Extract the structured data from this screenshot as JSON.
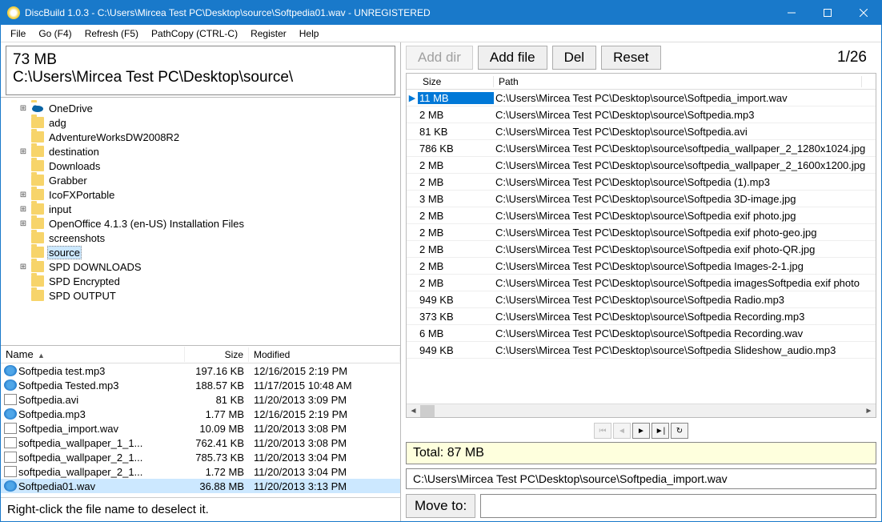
{
  "titlebar": {
    "title": "DiscBuild 1.0.3 - C:\\Users\\Mircea Test PC\\Desktop\\source\\Softpedia01.wav - UNREGISTERED"
  },
  "menu": {
    "file": "File",
    "go": "Go (F4)",
    "refresh": "Refresh (F5)",
    "pathcopy": "PathCopy (CTRL-C)",
    "register": "Register",
    "help": "Help"
  },
  "info": {
    "size": "73 MB",
    "path": "C:\\Users\\Mircea Test PC\\Desktop\\source\\"
  },
  "tree": [
    {
      "exp": "⊞",
      "icon": "onedrive",
      "label": "OneDrive",
      "indent": 1
    },
    {
      "exp": "",
      "icon": "folder",
      "label": "adg",
      "indent": 1
    },
    {
      "exp": "",
      "icon": "folder",
      "label": "AdventureWorksDW2008R2",
      "indent": 1
    },
    {
      "exp": "⊞",
      "icon": "folder",
      "label": "destination",
      "indent": 1
    },
    {
      "exp": "",
      "icon": "folder",
      "label": "Downloads",
      "indent": 1
    },
    {
      "exp": "",
      "icon": "folder",
      "label": "Grabber",
      "indent": 1
    },
    {
      "exp": "⊞",
      "icon": "folder",
      "label": "IcoFXPortable",
      "indent": 1
    },
    {
      "exp": "⊞",
      "icon": "folder",
      "label": "input",
      "indent": 1
    },
    {
      "exp": "⊞",
      "icon": "folder",
      "label": "OpenOffice 4.1.3 (en-US) Installation Files",
      "indent": 1
    },
    {
      "exp": "",
      "icon": "folder",
      "label": "screenshots",
      "indent": 1
    },
    {
      "exp": "",
      "icon": "folder",
      "label": "source",
      "indent": 1,
      "sel": true
    },
    {
      "exp": "⊞",
      "icon": "folder",
      "label": "SPD DOWNLOADS",
      "indent": 1
    },
    {
      "exp": "",
      "icon": "folder",
      "label": "SPD Encrypted",
      "indent": 1
    },
    {
      "exp": "",
      "icon": "folder",
      "label": "SPD OUTPUT",
      "indent": 1
    }
  ],
  "flcols": {
    "name": "Name",
    "size": "Size",
    "modified": "Modified"
  },
  "files": [
    {
      "icon": "audio",
      "name": "Softpedia test.mp3",
      "size": "197.16 KB",
      "mod": "12/16/2015 2:19 PM"
    },
    {
      "icon": "audio",
      "name": "Softpedia Tested.mp3",
      "size": "188.57 KB",
      "mod": "11/17/2015 10:48 AM"
    },
    {
      "icon": "doc",
      "name": "Softpedia.avi",
      "size": "81 KB",
      "mod": "11/20/2013 3:09 PM"
    },
    {
      "icon": "audio",
      "name": "Softpedia.mp3",
      "size": "1.77 MB",
      "mod": "12/16/2015 2:19 PM"
    },
    {
      "icon": "doc",
      "name": "Softpedia_import.wav",
      "size": "10.09 MB",
      "mod": "11/20/2013 3:08 PM"
    },
    {
      "icon": "doc",
      "name": "softpedia_wallpaper_1_1...",
      "size": "762.41 KB",
      "mod": "11/20/2013 3:08 PM"
    },
    {
      "icon": "doc",
      "name": "softpedia_wallpaper_2_1...",
      "size": "785.73 KB",
      "mod": "11/20/2013 3:04 PM"
    },
    {
      "icon": "doc",
      "name": "softpedia_wallpaper_2_1...",
      "size": "1.72 MB",
      "mod": "11/20/2013 3:04 PM"
    },
    {
      "icon": "audio",
      "name": "Softpedia01.wav",
      "size": "36.88 MB",
      "mod": "11/20/2013 3:13 PM",
      "sel": true
    }
  ],
  "hint": "Right-click the file name to deselect it.",
  "toolbar": {
    "adddir": "Add dir",
    "addfile": "Add file",
    "del": "Del",
    "reset": "Reset",
    "counter": "1/26"
  },
  "rtcols": {
    "size": "Size",
    "path": "Path"
  },
  "rows": [
    {
      "size": "11 MB",
      "path": "C:\\Users\\Mircea Test PC\\Desktop\\source\\Softpedia_import.wav",
      "sel": true
    },
    {
      "size": "2 MB",
      "path": "C:\\Users\\Mircea Test PC\\Desktop\\source\\Softpedia.mp3"
    },
    {
      "size": "81 KB",
      "path": "C:\\Users\\Mircea Test PC\\Desktop\\source\\Softpedia.avi"
    },
    {
      "size": "786 KB",
      "path": "C:\\Users\\Mircea Test PC\\Desktop\\source\\softpedia_wallpaper_2_1280x1024.jpg"
    },
    {
      "size": "2 MB",
      "path": "C:\\Users\\Mircea Test PC\\Desktop\\source\\softpedia_wallpaper_2_1600x1200.jpg"
    },
    {
      "size": "2 MB",
      "path": "C:\\Users\\Mircea Test PC\\Desktop\\source\\Softpedia (1).mp3"
    },
    {
      "size": "3 MB",
      "path": "C:\\Users\\Mircea Test PC\\Desktop\\source\\Softpedia 3D-image.jpg"
    },
    {
      "size": "2 MB",
      "path": "C:\\Users\\Mircea Test PC\\Desktop\\source\\Softpedia exif photo.jpg"
    },
    {
      "size": "2 MB",
      "path": "C:\\Users\\Mircea Test PC\\Desktop\\source\\Softpedia exif photo-geo.jpg"
    },
    {
      "size": "2 MB",
      "path": "C:\\Users\\Mircea Test PC\\Desktop\\source\\Softpedia exif photo-QR.jpg"
    },
    {
      "size": "2 MB",
      "path": "C:\\Users\\Mircea Test PC\\Desktop\\source\\Softpedia Images-2-1.jpg"
    },
    {
      "size": "2 MB",
      "path": "C:\\Users\\Mircea Test PC\\Desktop\\source\\Softpedia imagesSoftpedia exif photo"
    },
    {
      "size": "949 KB",
      "path": "C:\\Users\\Mircea Test PC\\Desktop\\source\\Softpedia Radio.mp3"
    },
    {
      "size": "373 KB",
      "path": "C:\\Users\\Mircea Test PC\\Desktop\\source\\Softpedia Recording.mp3"
    },
    {
      "size": "6 MB",
      "path": "C:\\Users\\Mircea Test PC\\Desktop\\source\\Softpedia Recording.wav"
    },
    {
      "size": "949 KB",
      "path": "C:\\Users\\Mircea Test PC\\Desktop\\source\\Softpedia Slideshow_audio.mp3"
    }
  ],
  "total": "Total: 87 MB",
  "currentpath": "C:\\Users\\Mircea Test PC\\Desktop\\source\\Softpedia_import.wav",
  "moveto": {
    "label": "Move to:",
    "value": ""
  }
}
